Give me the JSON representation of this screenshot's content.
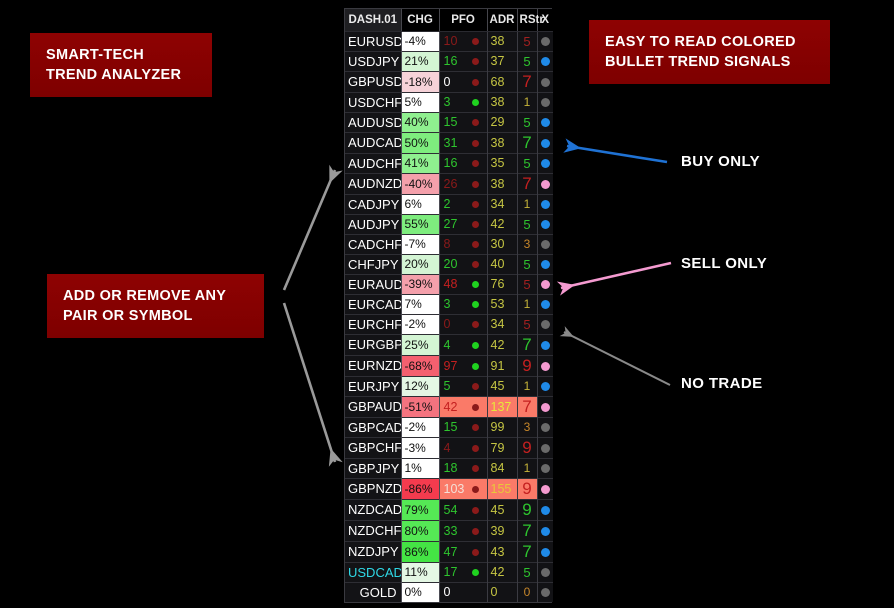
{
  "callouts": {
    "title": "SMART-TECH\nTREND ANALYZER",
    "title_line1": "SMART-TECH",
    "title_line2": "TREND ANALYZER",
    "bullets_line1": "EASY TO READ COLORED",
    "bullets_line2": "BULLET TREND SIGNALS",
    "pairs_line1": "ADD OR REMOVE ANY",
    "pairs_line2": "PAIR OR SYMBOL",
    "box_color": "#8b0000",
    "text_color": "#ffffff"
  },
  "annotations": {
    "buy": {
      "label": "BUY ONLY",
      "arrow_color": "#1f72d4"
    },
    "sell": {
      "label": "SELL ONLY",
      "arrow_color": "#f49ad0"
    },
    "no_trade": {
      "label": "NO TRADE",
      "arrow_color": "#8a8a8a"
    },
    "pairs_arrow_color": "#9a9a9a"
  },
  "dashboard": {
    "panel_name": "DASH.01",
    "columns": [
      "DASH.01",
      "CHG",
      "PFO",
      "ADR",
      "RStr",
      "X"
    ],
    "legend": {
      "blue": "buy-only",
      "pink": "sell-only",
      "gray": "no-trade",
      "green_dot": "pfo-up",
      "red_dot": "pfo-down"
    },
    "rows": [
      {
        "symbol": "EURUSD",
        "chg": "-4%",
        "chg_bg": "#ffffff",
        "pfo": "10",
        "pfo_color": "#8b1a1a",
        "dot": "#8b1a1a",
        "adr": "38",
        "rstr": "5",
        "rstr_color": "#a32020",
        "rstr_size": 13,
        "x": "#6a6a6a",
        "selected": false
      },
      {
        "symbol": "USDJPY",
        "chg": "21%",
        "chg_bg": "#d4f5d4",
        "pfo": "16",
        "pfo_color": "#2ec52e",
        "dot": "#8b1a1a",
        "adr": "37",
        "rstr": "5",
        "rstr_color": "#2ec52e",
        "rstr_size": 13,
        "x": "#1f8ae8",
        "selected": false
      },
      {
        "symbol": "GBPUSD",
        "chg": "-18%",
        "chg_bg": "#f6d2d8",
        "pfo": "0",
        "pfo_color": "#ffffff",
        "dot": "#8b1a1a",
        "adr": "68",
        "rstr": "7",
        "rstr_color": "#c42020",
        "rstr_size": 17,
        "x": "#6a6a6a",
        "selected": false
      },
      {
        "symbol": "USDCHF",
        "chg": "5%",
        "chg_bg": "#ffffff",
        "pfo": "3",
        "pfo_color": "#2ec52e",
        "dot": "#1fd21f",
        "adr": "38",
        "rstr": "1",
        "rstr_color": "#c6b43a",
        "rstr_size": 12,
        "x": "#6a6a6a",
        "selected": false
      },
      {
        "symbol": "AUDUSD",
        "chg": "40%",
        "chg_bg": "#8ff08f",
        "pfo": "15",
        "pfo_color": "#2ec52e",
        "dot": "#8b1a1a",
        "adr": "29",
        "rstr": "5",
        "rstr_color": "#2ec52e",
        "rstr_size": 13,
        "x": "#1f8ae8",
        "selected": false
      },
      {
        "symbol": "AUDCAD",
        "chg": "50%",
        "chg_bg": "#7eed7e",
        "pfo": "31",
        "pfo_color": "#2ec52e",
        "dot": "#8b1a1a",
        "adr": "38",
        "rstr": "7",
        "rstr_color": "#2ec52e",
        "rstr_size": 17,
        "x": "#1f8ae8",
        "selected": false
      },
      {
        "symbol": "AUDCHF",
        "chg": "41%",
        "chg_bg": "#8ff08f",
        "pfo": "16",
        "pfo_color": "#2ec52e",
        "dot": "#8b1a1a",
        "adr": "35",
        "rstr": "5",
        "rstr_color": "#2ec52e",
        "rstr_size": 13,
        "x": "#1f8ae8",
        "selected": false
      },
      {
        "symbol": "AUDNZD",
        "chg": "-40%",
        "chg_bg": "#f4a0ab",
        "pfo": "26",
        "pfo_color": "#8b1a1a",
        "dot": "#8b1a1a",
        "adr": "38",
        "rstr": "7",
        "rstr_color": "#c42020",
        "rstr_size": 17,
        "x": "#f49ad0",
        "selected": false
      },
      {
        "symbol": "CADJPY",
        "chg": "6%",
        "chg_bg": "#ffffff",
        "pfo": "2",
        "pfo_color": "#2ec52e",
        "dot": "#8b1a1a",
        "adr": "34",
        "rstr": "1",
        "rstr_color": "#c6b43a",
        "rstr_size": 12,
        "x": "#1f8ae8",
        "selected": false
      },
      {
        "symbol": "AUDJPY",
        "chg": "55%",
        "chg_bg": "#7eed7e",
        "pfo": "27",
        "pfo_color": "#2ec52e",
        "dot": "#8b1a1a",
        "adr": "42",
        "rstr": "5",
        "rstr_color": "#2ec52e",
        "rstr_size": 13,
        "x": "#1f8ae8",
        "selected": false
      },
      {
        "symbol": "CADCHF",
        "chg": "-7%",
        "chg_bg": "#ffffff",
        "pfo": "8",
        "pfo_color": "#8b1a1a",
        "dot": "#8b1a1a",
        "adr": "30",
        "rstr": "3",
        "rstr_color": "#c6862a",
        "rstr_size": 12,
        "x": "#6a6a6a",
        "selected": false
      },
      {
        "symbol": "CHFJPY",
        "chg": "20%",
        "chg_bg": "#d4f5d4",
        "pfo": "20",
        "pfo_color": "#2ec52e",
        "dot": "#8b1a1a",
        "adr": "40",
        "rstr": "5",
        "rstr_color": "#2ec52e",
        "rstr_size": 13,
        "x": "#1f8ae8",
        "selected": false
      },
      {
        "symbol": "EURAUD",
        "chg": "-39%",
        "chg_bg": "#f4a0ab",
        "pfo": "48",
        "pfo_color": "#c42020",
        "dot": "#1fd21f",
        "adr": "76",
        "rstr": "5",
        "rstr_color": "#a32020",
        "rstr_size": 13,
        "x": "#f49ad0",
        "selected": false
      },
      {
        "symbol": "EURCAD",
        "chg": "7%",
        "chg_bg": "#ffffff",
        "pfo": "3",
        "pfo_color": "#2ec52e",
        "dot": "#1fd21f",
        "adr": "53",
        "rstr": "1",
        "rstr_color": "#c6b43a",
        "rstr_size": 12,
        "x": "#1f8ae8",
        "selected": false
      },
      {
        "symbol": "EURCHF",
        "chg": "-2%",
        "chg_bg": "#ffffff",
        "pfo": "0",
        "pfo_color": "#8b1a1a",
        "dot": "#8b1a1a",
        "adr": "34",
        "rstr": "5",
        "rstr_color": "#a32020",
        "rstr_size": 13,
        "x": "#6a6a6a",
        "selected": false
      },
      {
        "symbol": "EURGBP",
        "chg": "25%",
        "chg_bg": "#d4f5d4",
        "pfo": "4",
        "pfo_color": "#2ec52e",
        "dot": "#1fd21f",
        "adr": "42",
        "rstr": "7",
        "rstr_color": "#2ec52e",
        "rstr_size": 17,
        "x": "#1f8ae8",
        "selected": false
      },
      {
        "symbol": "EURNZD",
        "chg": "-68%",
        "chg_bg": "#f4606f",
        "pfo": "97",
        "pfo_color": "#c42020",
        "dot": "#1fd21f",
        "adr": "91",
        "rstr": "9",
        "rstr_color": "#c42020",
        "rstr_size": 17,
        "x": "#f49ad0",
        "selected": false
      },
      {
        "symbol": "EURJPY",
        "chg": "12%",
        "chg_bg": "#e4f7e4",
        "pfo": "5",
        "pfo_color": "#2ec52e",
        "dot": "#8b1a1a",
        "adr": "45",
        "rstr": "1",
        "rstr_color": "#c6b43a",
        "rstr_size": 12,
        "x": "#1f8ae8",
        "selected": false
      },
      {
        "symbol": "GBPAUD",
        "chg": "-51%",
        "chg_bg": "#f4737f",
        "pfo": "42",
        "pfo_color": "#c42020",
        "pfo_bg": "#fa7a68",
        "dot": "#8b1a1a",
        "adr": "137",
        "adr_bg": "#fa7a68",
        "adr_color": "#e8e83a",
        "rstr": "7",
        "rstr_color": "#c42020",
        "rstr_bg": "#fa7a68",
        "rstr_size": 17,
        "x": "#f49ad0",
        "selected": false
      },
      {
        "symbol": "GBPCAD",
        "chg": "-2%",
        "chg_bg": "#ffffff",
        "pfo": "15",
        "pfo_color": "#2ec52e",
        "dot": "#8b1a1a",
        "adr": "99",
        "rstr": "3",
        "rstr_color": "#c6862a",
        "rstr_size": 12,
        "x": "#6a6a6a",
        "selected": false
      },
      {
        "symbol": "GBPCHF",
        "chg": "-3%",
        "chg_bg": "#ffffff",
        "pfo": "4",
        "pfo_color": "#8b1a1a",
        "dot": "#8b1a1a",
        "adr": "79",
        "rstr": "9",
        "rstr_color": "#c42020",
        "rstr_size": 17,
        "x": "#6a6a6a",
        "selected": false
      },
      {
        "symbol": "GBPJPY",
        "chg": "1%",
        "chg_bg": "#ffffff",
        "pfo": "18",
        "pfo_color": "#2ec52e",
        "dot": "#8b1a1a",
        "adr": "84",
        "rstr": "1",
        "rstr_color": "#c6b43a",
        "rstr_size": 12,
        "x": "#6a6a6a",
        "selected": false
      },
      {
        "symbol": "GBPNZD",
        "chg": "-86%",
        "chg_bg": "#f43b4e",
        "pfo": "103",
        "pfo_color": "#f4e0d8",
        "pfo_bg": "#fa7a68",
        "dot": "#8b1a1a",
        "adr": "155",
        "adr_bg": "#fa7a68",
        "adr_color": "#e8c83a",
        "rstr": "9",
        "rstr_color": "#c42020",
        "rstr_bg": "#fa7a68",
        "rstr_size": 17,
        "x": "#f49ad0",
        "selected": false
      },
      {
        "symbol": "NZDCAD",
        "chg": "79%",
        "chg_bg": "#55e855",
        "pfo": "54",
        "pfo_color": "#2ec52e",
        "dot": "#8b1a1a",
        "adr": "45",
        "rstr": "9",
        "rstr_color": "#2ec52e",
        "rstr_size": 17,
        "x": "#1f8ae8",
        "selected": false
      },
      {
        "symbol": "NZDCHF",
        "chg": "80%",
        "chg_bg": "#55e855",
        "pfo": "33",
        "pfo_color": "#2ec52e",
        "dot": "#8b1a1a",
        "adr": "39",
        "rstr": "7",
        "rstr_color": "#2ec52e",
        "rstr_size": 17,
        "x": "#1f8ae8",
        "selected": false
      },
      {
        "symbol": "NZDJPY",
        "chg": "86%",
        "chg_bg": "#44e444",
        "pfo": "47",
        "pfo_color": "#2ec52e",
        "dot": "#8b1a1a",
        "adr": "43",
        "rstr": "7",
        "rstr_color": "#2ec52e",
        "rstr_size": 17,
        "x": "#1f8ae8",
        "selected": false
      },
      {
        "symbol": "USDCAD",
        "chg": "11%",
        "chg_bg": "#e4f7e4",
        "pfo": "17",
        "pfo_color": "#2ec52e",
        "dot": "#1fd21f",
        "adr": "42",
        "rstr": "5",
        "rstr_color": "#2ec52e",
        "rstr_size": 13,
        "x": "#6a6a6a",
        "selected": true
      },
      {
        "symbol": "GOLD",
        "chg": "0%",
        "chg_bg": "#ffffff",
        "pfo": "0",
        "pfo_color": "#ffffff",
        "dot": "",
        "adr": "0",
        "adr_color": "#c6c643",
        "rstr": "0",
        "rstr_color": "#c6862a",
        "rstr_size": 12,
        "x": "#6a6a6a",
        "selected": false
      }
    ]
  }
}
